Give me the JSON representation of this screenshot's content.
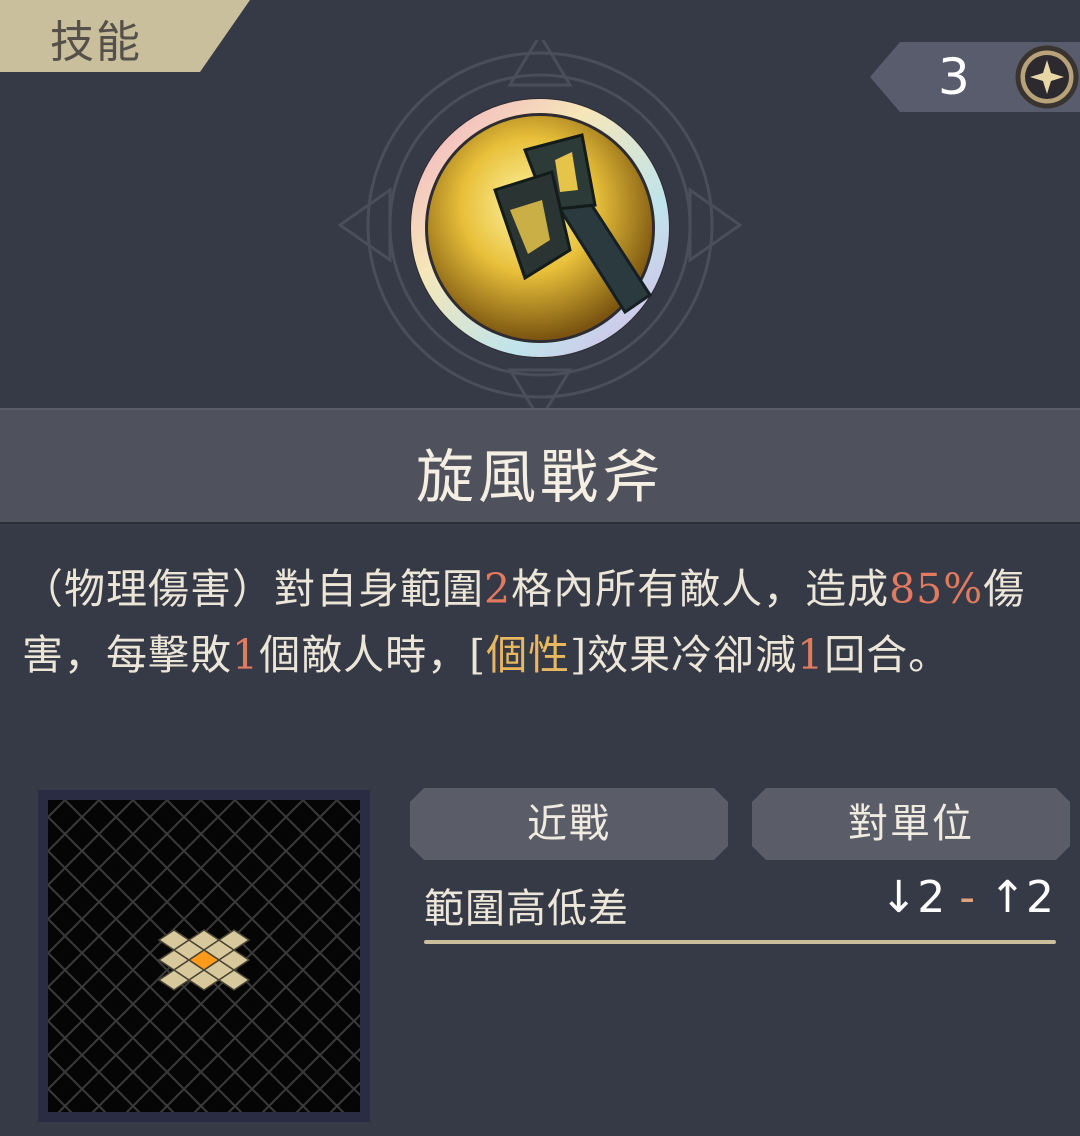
{
  "header": {
    "section_label": "技能",
    "cost": "3",
    "cost_icon": "sparkle-coin-icon"
  },
  "skill": {
    "icon": "battle-axe-icon",
    "name": "旋風戰斧",
    "description": {
      "p1": "（物理傷害）對自身範圍",
      "range": "2",
      "p2": "格內所有敵人，造成",
      "damage": "85%",
      "p3": "傷害，每擊敗",
      "kills": "1",
      "p4": "個敵人時，[",
      "trait": "個性",
      "p5": "]效果冷卻減",
      "cooldown": "1",
      "p6": "回合。"
    }
  },
  "tags": {
    "attack_type": "近戰",
    "target_type": "對單位"
  },
  "height": {
    "label": "範圍高低差",
    "down": "↓2",
    "separator": "-",
    "up": "↑2"
  },
  "colors": {
    "background": "#363946",
    "accent_gold": "#c9bf9c",
    "highlight_red": "#e07a60",
    "highlight_gold": "#e8b860",
    "range_tile": "#d8c99c",
    "range_center": "#ff9a1a"
  }
}
